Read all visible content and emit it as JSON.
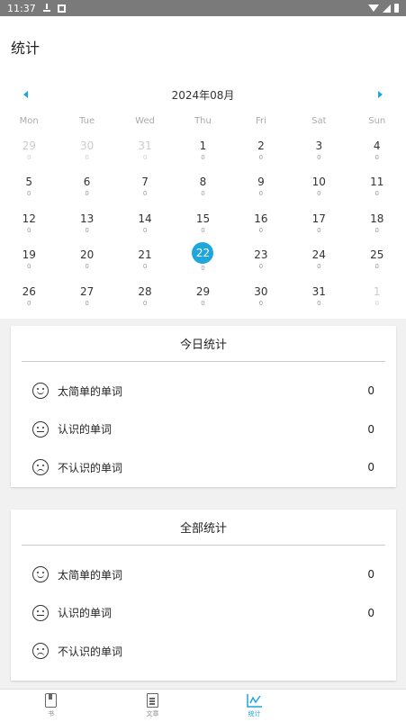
{
  "status_bar": {
    "time": "11:37"
  },
  "app_bar": {
    "title": "统计"
  },
  "calendar": {
    "month_label": "2024年08月",
    "weekdays": [
      "Mon",
      "Tue",
      "Wed",
      "Thu",
      "Fri",
      "Sat",
      "Sun"
    ],
    "weeks": [
      [
        {
          "d": "29",
          "c": "0",
          "muted": true
        },
        {
          "d": "30",
          "c": "0",
          "muted": true
        },
        {
          "d": "31",
          "c": "0",
          "muted": true
        },
        {
          "d": "1",
          "c": "0"
        },
        {
          "d": "2",
          "c": "0"
        },
        {
          "d": "3",
          "c": "0"
        },
        {
          "d": "4",
          "c": "0"
        }
      ],
      [
        {
          "d": "5",
          "c": "0"
        },
        {
          "d": "6",
          "c": "0"
        },
        {
          "d": "7",
          "c": "0"
        },
        {
          "d": "8",
          "c": "0"
        },
        {
          "d": "9",
          "c": "0"
        },
        {
          "d": "10",
          "c": "0"
        },
        {
          "d": "11",
          "c": "0"
        }
      ],
      [
        {
          "d": "12",
          "c": "0"
        },
        {
          "d": "13",
          "c": "0"
        },
        {
          "d": "14",
          "c": "0"
        },
        {
          "d": "15",
          "c": "0"
        },
        {
          "d": "16",
          "c": "0"
        },
        {
          "d": "17",
          "c": "0"
        },
        {
          "d": "18",
          "c": "0"
        }
      ],
      [
        {
          "d": "19",
          "c": "0"
        },
        {
          "d": "20",
          "c": "0"
        },
        {
          "d": "21",
          "c": "0"
        },
        {
          "d": "22",
          "c": "0",
          "today": true
        },
        {
          "d": "23",
          "c": "0"
        },
        {
          "d": "24",
          "c": "0"
        },
        {
          "d": "25",
          "c": "0"
        }
      ],
      [
        {
          "d": "26",
          "c": "0"
        },
        {
          "d": "27",
          "c": "0"
        },
        {
          "d": "28",
          "c": "0"
        },
        {
          "d": "29",
          "c": "0"
        },
        {
          "d": "30",
          "c": "0"
        },
        {
          "d": "31",
          "c": "0"
        },
        {
          "d": "1",
          "c": "0",
          "muted": true
        }
      ]
    ]
  },
  "today_stats": {
    "title": "今日统计",
    "rows": [
      {
        "icon": "happy-face-icon",
        "label": "太简单的单词",
        "value": "0"
      },
      {
        "icon": "neutral-face-icon",
        "label": "认识的单词",
        "value": "0"
      },
      {
        "icon": "sad-face-icon",
        "label": "不认识的单词",
        "value": "0"
      }
    ]
  },
  "total_stats": {
    "title": "全部统计",
    "rows": [
      {
        "icon": "happy-face-icon",
        "label": "太简单的单词",
        "value": "0"
      },
      {
        "icon": "neutral-face-icon",
        "label": "认识的单词",
        "value": "0"
      },
      {
        "icon": "sad-face-icon",
        "label": "不认识的单词",
        "value": ""
      }
    ]
  },
  "bottom_nav": [
    {
      "label": "书",
      "icon": "book-icon"
    },
    {
      "label": "文章",
      "icon": "document-icon"
    },
    {
      "label": "统计",
      "icon": "chart-icon",
      "active": true
    }
  ],
  "colors": {
    "accent": "#1fa6dd",
    "status_bar": "#7a7a7a"
  }
}
